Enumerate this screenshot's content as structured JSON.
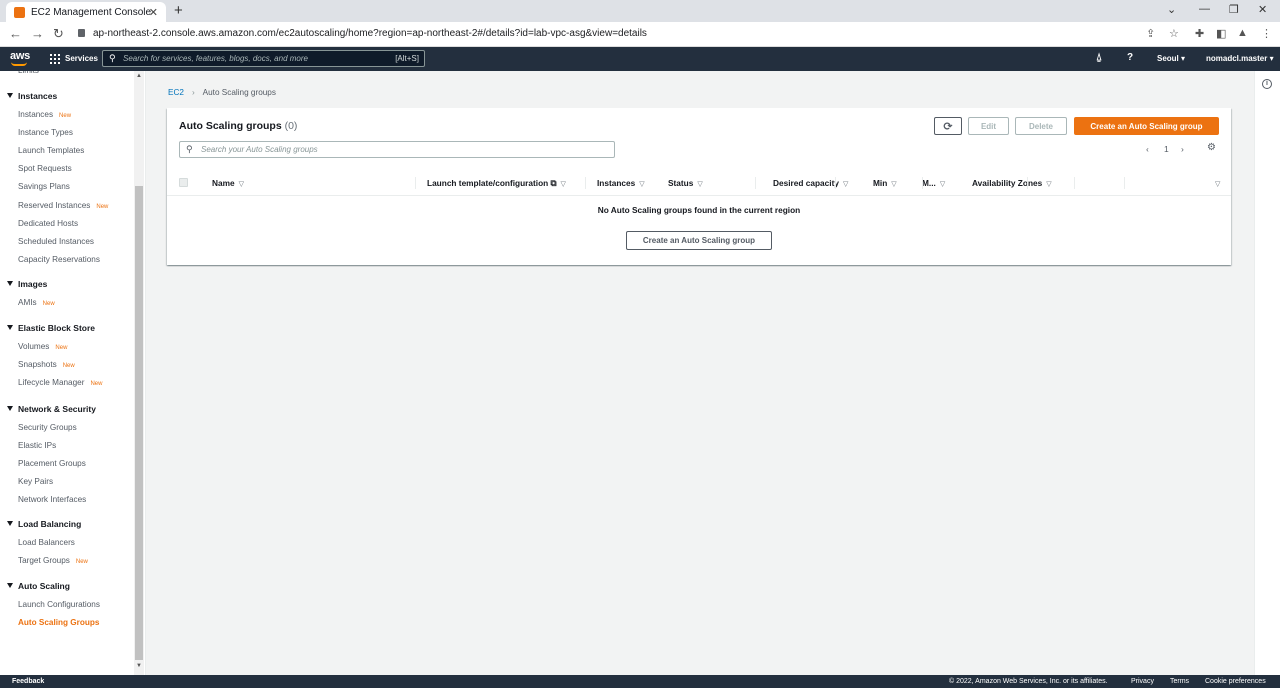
{
  "browser": {
    "tab_title": "EC2 Management Console",
    "url": "ap-northeast-2.console.aws.amazon.com/ec2autoscaling/home?region=ap-northeast-2#/details?id=lab-vpc-asg&view=details"
  },
  "topnav": {
    "logo": "aws",
    "services_label": "Services",
    "search_placeholder": "Search for services, features, blogs, docs, and more",
    "search_shortcut": "[Alt+S]",
    "region": "Seoul ▾",
    "account": "nomadcl.master ▾"
  },
  "sidebar": {
    "cut_item": "Limits",
    "sections": [
      {
        "title": "Instances",
        "items": [
          {
            "label": "Instances",
            "badge": "New"
          },
          {
            "label": "Instance Types",
            "badge": ""
          },
          {
            "label": "Launch Templates",
            "badge": ""
          },
          {
            "label": "Spot Requests",
            "badge": ""
          },
          {
            "label": "Savings Plans",
            "badge": ""
          },
          {
            "label": "Reserved Instances",
            "badge": "New"
          },
          {
            "label": "Dedicated Hosts",
            "badge": ""
          },
          {
            "label": "Scheduled Instances",
            "badge": ""
          },
          {
            "label": "Capacity Reservations",
            "badge": ""
          }
        ]
      },
      {
        "title": "Images",
        "items": [
          {
            "label": "AMIs",
            "badge": "New"
          }
        ]
      },
      {
        "title": "Elastic Block Store",
        "items": [
          {
            "label": "Volumes",
            "badge": "New"
          },
          {
            "label": "Snapshots",
            "badge": "New"
          },
          {
            "label": "Lifecycle Manager",
            "badge": "New"
          }
        ]
      },
      {
        "title": "Network & Security",
        "items": [
          {
            "label": "Security Groups",
            "badge": ""
          },
          {
            "label": "Elastic IPs",
            "badge": ""
          },
          {
            "label": "Placement Groups",
            "badge": ""
          },
          {
            "label": "Key Pairs",
            "badge": ""
          },
          {
            "label": "Network Interfaces",
            "badge": ""
          }
        ]
      },
      {
        "title": "Load Balancing",
        "items": [
          {
            "label": "Load Balancers",
            "badge": ""
          },
          {
            "label": "Target Groups",
            "badge": "New"
          }
        ]
      },
      {
        "title": "Auto Scaling",
        "items": [
          {
            "label": "Launch Configurations",
            "badge": ""
          },
          {
            "label": "Auto Scaling Groups",
            "badge": "",
            "active": true
          }
        ]
      }
    ]
  },
  "breadcrumb": {
    "root": "EC2",
    "current": "Auto Scaling groups"
  },
  "panel": {
    "title": "Auto Scaling groups",
    "count": "(0)",
    "edit": "Edit",
    "delete": "Delete",
    "create": "Create an Auto Scaling group",
    "search_placeholder": "Search your Auto Scaling groups",
    "page": "1",
    "columns": [
      "Name",
      "Launch template/configuration",
      "Instances",
      "Status",
      "Desired capacity",
      "Min",
      "M...",
      "Availability Zones"
    ],
    "empty_message": "No Auto Scaling groups found in the current region",
    "empty_create": "Create an Auto Scaling group"
  },
  "footer": {
    "feedback": "Feedback",
    "copyright": "© 2022, Amazon Web Services, Inc. or its affiliates.",
    "privacy": "Privacy",
    "terms": "Terms",
    "cookies": "Cookie preferences"
  }
}
